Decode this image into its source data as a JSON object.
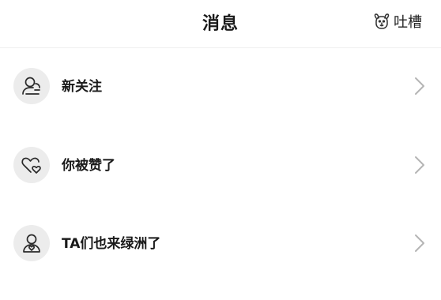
{
  "header": {
    "title": "消息",
    "feedback_label": "吐槽",
    "feedback_icon": "dog-face-icon"
  },
  "messages": [
    {
      "label": "新关注",
      "icon": "follower-icon"
    },
    {
      "label": "你被赞了",
      "icon": "liked-heart-icon"
    },
    {
      "label": "TA们也来绿洲了",
      "icon": "user-heart-icon"
    }
  ],
  "colors": {
    "icon_bg": "#ececec",
    "chevron": "#b5b5b5",
    "text": "#1a1a1a"
  }
}
